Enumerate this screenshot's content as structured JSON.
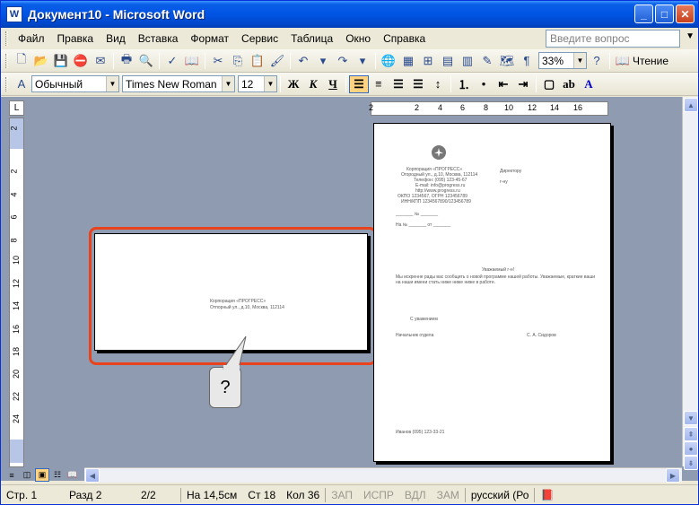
{
  "window": {
    "title": "Документ10 - Microsoft Word",
    "app_icon_letter": "W",
    "minimize": "_",
    "maximize": "□",
    "close": "✕"
  },
  "menu": {
    "items": [
      "Файл",
      "Правка",
      "Вид",
      "Вставка",
      "Формат",
      "Сервис",
      "Таблица",
      "Окно",
      "Справка"
    ],
    "help_placeholder": "Введите вопрос"
  },
  "standard_toolbar": {
    "zoom": "33%",
    "reading_label": "Чтение"
  },
  "format_toolbar": {
    "style": "Обычный",
    "font": "Times New Roman",
    "size": "12",
    "bold": "Ж",
    "italic": "К",
    "underline": "Ч"
  },
  "ruler": {
    "h_numbers": [
      "2",
      "2",
      "4",
      "6",
      "8",
      "10",
      "12",
      "14",
      "16"
    ],
    "v_numbers": [
      "2",
      "2",
      "4",
      "6",
      "8",
      "10",
      "12",
      "14",
      "16",
      "18",
      "20",
      "22",
      "24"
    ]
  },
  "envelope": {
    "line1": "Корпорация «ПРОГРЕСС»",
    "line2": "Отпорный ул., д.10, Москва, 112114"
  },
  "page": {
    "company": "Корпорация «ПРОГРЕСС»",
    "address": "Огородный ул., д.10, Москва, 112114",
    "phone": "Телефон: (095) 123-45-67",
    "email": "E-mail: info@progress.ru",
    "web": "http://www.progress.ru",
    "codes1": "ОКПО 1234567, ОГРН 123456789",
    "codes2": "ИНН/КПП 1234567890/123456789",
    "to_title": "Директору",
    "to_name": "г-ну",
    "num_line": "_______ № _______",
    "ref_line": "На № _______ от _______",
    "salutation": "Уважаемый г-н!",
    "body": "Мы искренне рады вас сообщить о новой программе нашей работы. Уважаемые, краткие ваши на наши имени стать ниже ниже ниже в работе.",
    "closing": "С уважением",
    "signer_title": "Начальник отдела",
    "signer_name": "С. А. Сидоров",
    "footer": "Иванов (095) 123-33-21"
  },
  "callout": {
    "text": "?"
  },
  "status": {
    "page": "Стр. 1",
    "section": "Разд 2",
    "pages": "2/2",
    "at": "На 14,5см",
    "line": "Ст 18",
    "col": "Кол 36",
    "rec": "ЗАП",
    "trk": "ИСПР",
    "ext": "ВДЛ",
    "ovr": "ЗАМ",
    "lang": "русский (Ро"
  },
  "colors": {
    "title_blue": "#0054e3",
    "workspace": "#8f9bb0",
    "highlight": "#e8431c"
  }
}
